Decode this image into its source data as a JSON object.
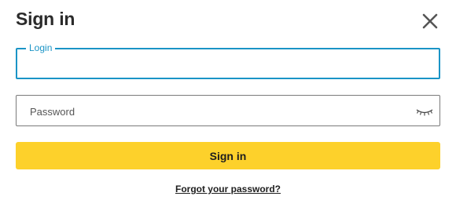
{
  "dialog": {
    "title": "Sign in",
    "close_icon": "close-icon"
  },
  "login": {
    "label": "Login",
    "value": ""
  },
  "password": {
    "placeholder": "Password",
    "value": "",
    "toggle_icon": "eye-closed-icon"
  },
  "submit": {
    "label": "Sign in",
    "color": "#fdd12b"
  },
  "forgot": {
    "label": "Forgot your password?"
  },
  "colors": {
    "focus_accent": "#1a94c6",
    "text": "#2b2b2b"
  }
}
